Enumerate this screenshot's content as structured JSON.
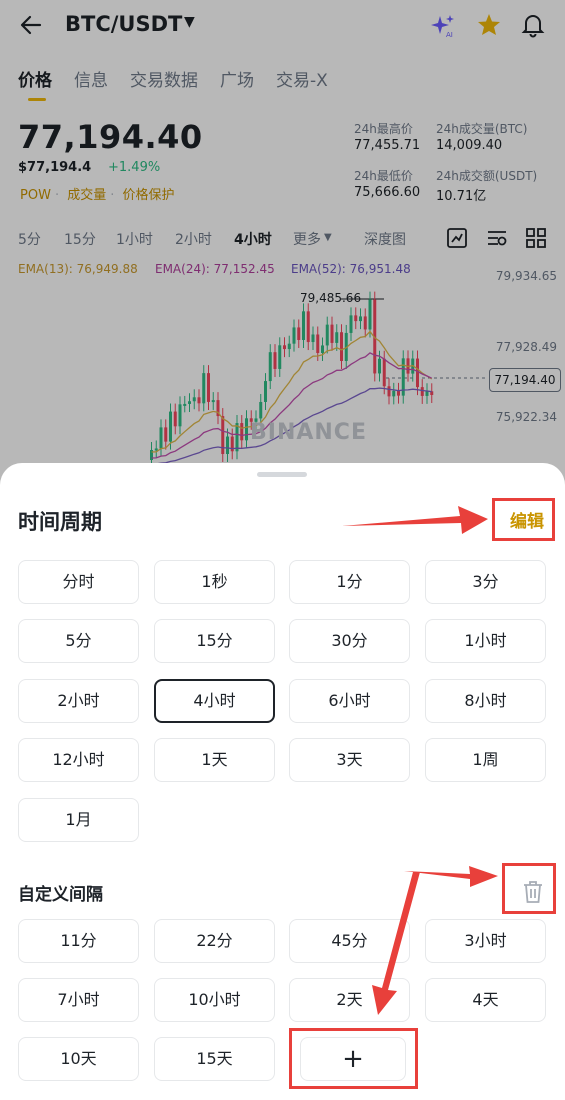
{
  "header": {
    "pair": "BTC/USDT"
  },
  "top_tabs": [
    "价格",
    "信息",
    "交易数据",
    "广场",
    "交易-X"
  ],
  "price": {
    "last": "77,194.40",
    "usd": "$77,194.4",
    "change": "+1.49%",
    "tags": [
      "POW",
      "成交量",
      "价格保护"
    ]
  },
  "stats": {
    "high_label": "24h最高价",
    "high": "77,455.71",
    "low_label": "24h最低价",
    "low": "75,666.60",
    "vol_btc_label": "24h成交量(BTC)",
    "vol_btc": "14,009.40",
    "vol_usdt_label": "24h成交额(USDT)",
    "vol_usdt": "10.71亿"
  },
  "chart_intervals": [
    "5分",
    "15分",
    "1小时",
    "2小时",
    "4小时",
    "更多",
    "深度图"
  ],
  "chart_intervals_active": "4小时",
  "ema": {
    "ema13": "EMA(13): 76,949.88",
    "ema24": "EMA(24): 77,152.45",
    "ema52": "EMA(52): 76,951.48"
  },
  "chart": {
    "ticks": [
      "79,934.65",
      "77,928.49",
      "75,922.34"
    ],
    "high_marker": "79,485.66",
    "current": "77,194.40",
    "watermark": "BINANCE"
  },
  "colors": {
    "accent": "#f0b90b",
    "up": "#2ebd85",
    "down": "#f6465d",
    "ema13": "#e0b94a",
    "ema24": "#c24fb0",
    "ema52": "#7d63c8",
    "annotation_red": "#e8403b"
  },
  "sheet": {
    "title": "时间周期",
    "edit_label": "编辑",
    "intervals": [
      "分时",
      "1秒",
      "1分",
      "3分",
      "5分",
      "15分",
      "30分",
      "1小时",
      "2小时",
      "4小时",
      "6小时",
      "8小时",
      "12小时",
      "1天",
      "3天",
      "1周",
      "1月"
    ],
    "selected": "4小时",
    "custom_title": "自定义间隔",
    "custom_intervals": [
      "11分",
      "22分",
      "45分",
      "3小时",
      "7小时",
      "10小时",
      "2天",
      "4天",
      "10天",
      "15天"
    ],
    "add_label": "+"
  }
}
